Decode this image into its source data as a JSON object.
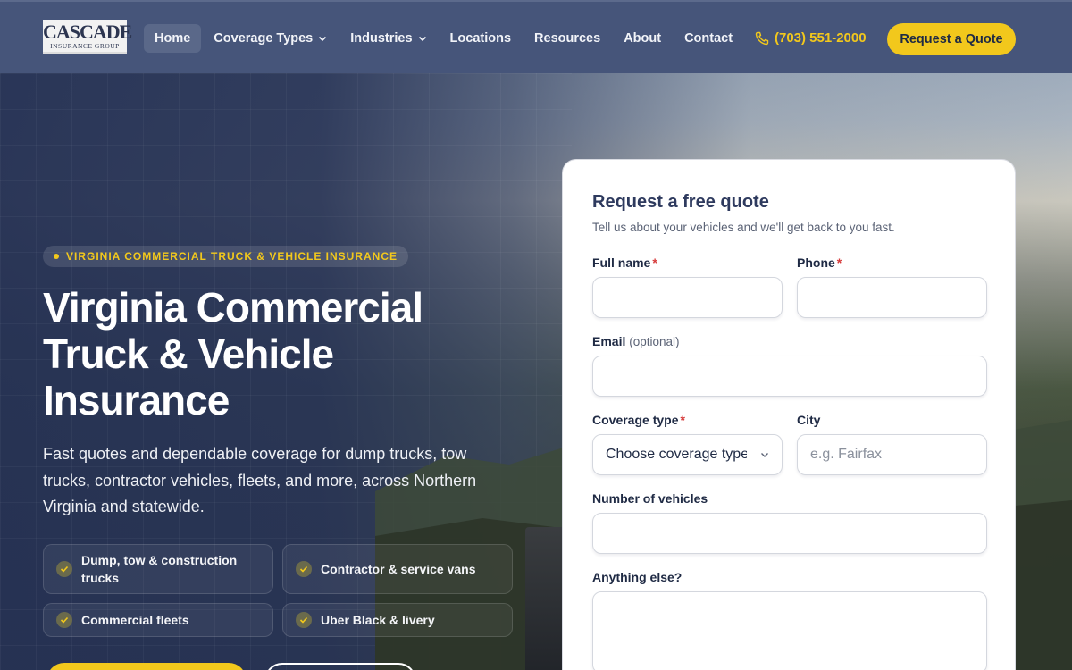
{
  "brand": {
    "logo_main": "CASCADE",
    "logo_sub": "INSURANCE GROUP"
  },
  "nav": {
    "items": [
      {
        "label": "Home",
        "active": true,
        "dropdown": false
      },
      {
        "label": "Coverage Types",
        "active": false,
        "dropdown": true
      },
      {
        "label": "Industries",
        "active": false,
        "dropdown": true
      },
      {
        "label": "Locations",
        "active": false,
        "dropdown": false
      },
      {
        "label": "Resources",
        "active": false,
        "dropdown": false
      },
      {
        "label": "About",
        "active": false,
        "dropdown": false
      },
      {
        "label": "Contact",
        "active": false,
        "dropdown": false
      }
    ],
    "phone": "(703) 551-2000",
    "cta": "Request a Quote"
  },
  "hero": {
    "eyebrow": "VIRGINIA COMMERCIAL TRUCK & VEHICLE INSURANCE",
    "title_line1": "Virginia Commercial",
    "title_line2": "Truck & Vehicle",
    "title_line3": "Insurance",
    "subtitle": "Fast quotes and dependable coverage for dump trucks, tow trucks, contractor vehicles, fleets, and more, across Northern Virginia and statewide.",
    "features": [
      "Dump, tow & construction trucks",
      "Contractor & service vans",
      "Commercial fleets",
      "Uber Black & livery"
    ]
  },
  "form": {
    "title": "Request a free quote",
    "subtitle": "Tell us about your vehicles and we'll get back to you fast.",
    "full_name_label": "Full name",
    "phone_label": "Phone",
    "email_label": "Email",
    "email_optional": "(optional)",
    "coverage_label": "Coverage type",
    "coverage_placeholder": "Choose coverage type",
    "city_label": "City",
    "city_placeholder": "e.g. Fairfax",
    "vehicles_label": "Number of vehicles",
    "anything_label": "Anything else?",
    "required_mark": "*",
    "full_name_value": "",
    "phone_value": "",
    "email_value": "",
    "city_value": "",
    "vehicles_value": "",
    "anything_value": ""
  },
  "colors": {
    "nav_bg": "#46557a",
    "accent_yellow": "#f2c81c",
    "required_red": "#d63b3b",
    "text_dark": "#1f2a44"
  },
  "icons": [
    "phone-icon",
    "chevron-down-icon",
    "check-icon"
  ]
}
